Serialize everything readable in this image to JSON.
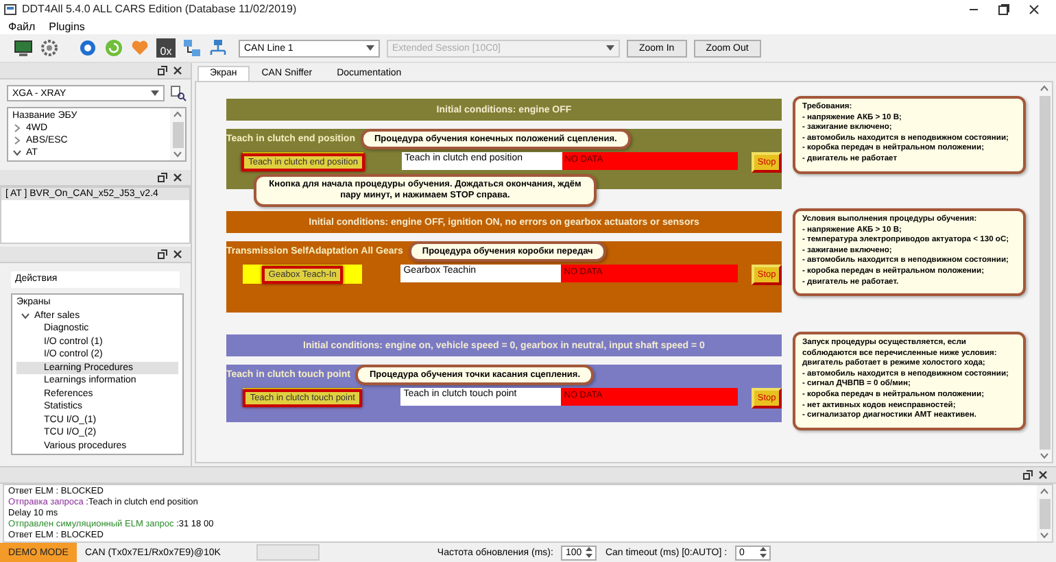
{
  "window": {
    "title": "DDT4All 5.4.0 ALL CARS Edition (Database 11/02/2019)"
  },
  "menu": [
    "Файл",
    "Plugins"
  ],
  "toolbar": {
    "hex_label": "0x",
    "can_line": "CAN Line 1",
    "session": {
      "value": "Extended Session [10C0]",
      "disabled": true
    },
    "buttons": [
      "Zoom In",
      "Zoom Out"
    ]
  },
  "ecu_panel": {
    "vehicle": "XGA - XRAY",
    "tree_header": "Название ЭБУ",
    "items": [
      {
        "label": "4WD",
        "expanded": false
      },
      {
        "label": "ABS/ESC",
        "expanded": false
      },
      {
        "label": "AT",
        "expanded": true
      }
    ]
  },
  "ecu_file_panel": {
    "items": [
      {
        "label": "[ AT ] BVR_On_CAN_x52_J53_v2.4",
        "selected": true
      }
    ]
  },
  "actions_panel": {
    "label": "Действия",
    "root": "Экраны",
    "groups": [
      {
        "label": "After sales",
        "expanded": true,
        "children": [
          {
            "label": "Diagnostic",
            "selected": false
          },
          {
            "label": "I/O control (1)",
            "selected": false
          },
          {
            "label": "I/O control (2)",
            "selected": false
          },
          {
            "label": "Learning Procedures",
            "selected": true
          },
          {
            "label": "Learnings information",
            "selected": false
          },
          {
            "label": "References",
            "selected": false
          },
          {
            "label": "Statistics",
            "selected": false
          },
          {
            "label": "TCU I/O_(1)",
            "selected": false
          },
          {
            "label": "TCU I/O_(2)",
            "selected": false
          },
          {
            "label": "Various procedures",
            "selected": false
          }
        ]
      }
    ]
  },
  "tabs": [
    {
      "label": "Экран",
      "selected": true
    },
    {
      "label": "CAN Sniffer",
      "selected": false
    },
    {
      "label": "Documentation",
      "selected": false
    }
  ],
  "sections": [
    {
      "color": "#807f35",
      "header": "Initial conditions: engine OFF",
      "title": "Teach in clutch end position",
      "tooltip": "Процедура обучения конечных положений сцепления.",
      "button": "Teach in clutch end position",
      "field_value": "Teach in clutch end position",
      "status": "NO DATA",
      "stop": "Stop",
      "hint": "Кнопка для начала процедуры обучения. Дождаться окончания, ждём пару минут, и нажимаем STOP справа.",
      "note": "Требования:\n- напряжение АКБ > 10 В;\n- зажигание включено;\n- автомобиль находится в неподвижном состоянии;\n- коробка передач в нейтральном положении;\n- двигатель не работает"
    },
    {
      "color": "#c06000",
      "header": "Initial conditions: engine OFF, ignition ON, no errors on gearbox actuators or sensors",
      "title": "Transmission SelfAdaptation All Gears",
      "tooltip": "Процедура обучения коробки передач",
      "button": "Geabox Teach-In",
      "field_value": "Gearbox Teachin",
      "status": "NO DATA",
      "stop": "Stop",
      "note": "Условия выполнения процедуры обучения:\n- напряжение АКБ > 10 В;\n- температура электроприводов актуатора < 130 оС;\n- зажигание включено;\n- автомобиль находится в неподвижном состоянии;\n- коробка передач в нейтральном положении;\n- двигатель не работает."
    },
    {
      "color": "#7b7bc4",
      "header": "Initial conditions: engine on, vehicle speed = 0, gearbox in neutral, input shaft speed = 0",
      "title": "Teach in clutch touch point",
      "tooltip": "Процедура обучения точки касания сцепления.",
      "button": "Teach in clutch touch point",
      "field_value": "Teach in clutch touch point",
      "status": "NO DATA",
      "stop": "Stop",
      "note": "Запуск процедуры осуществляется, если соблюдаются все перечисленные ниже условия:\nдвигатель работает в режиме холостого хода;\n- автомобиль находится в неподвижном состоянии;\n- сигнал ДЧВПВ = 0 об/мин;\n- коробка передач в нейтральном положении;\n- нет активных кодов неисправностей;\n- сигнализатор диагностики АМТ неактивен."
    }
  ],
  "log": [
    {
      "kind": "response",
      "text": "Ответ ELM : BLOCKED"
    },
    {
      "kind": "request",
      "prefix": "Отправка запроса",
      "text": ":Teach in clutch end position"
    },
    {
      "kind": "plain",
      "text": "Delay 10 ms"
    },
    {
      "kind": "simulated",
      "prefix": "Отправлен симуляционный ELM запрос",
      "text": ":31 18 00"
    },
    {
      "kind": "response",
      "text": "Ответ ELM : BLOCKED"
    }
  ],
  "status_bar": {
    "mode": "DEMO MODE",
    "can": "CAN (Tx0x7E1/Rx0x7E9)@10K",
    "refresh_label": "Частота обновления (ms):",
    "refresh_value": "100",
    "timeout_label": "Can timeout (ms) [0:AUTO] :",
    "timeout_value": "0"
  }
}
